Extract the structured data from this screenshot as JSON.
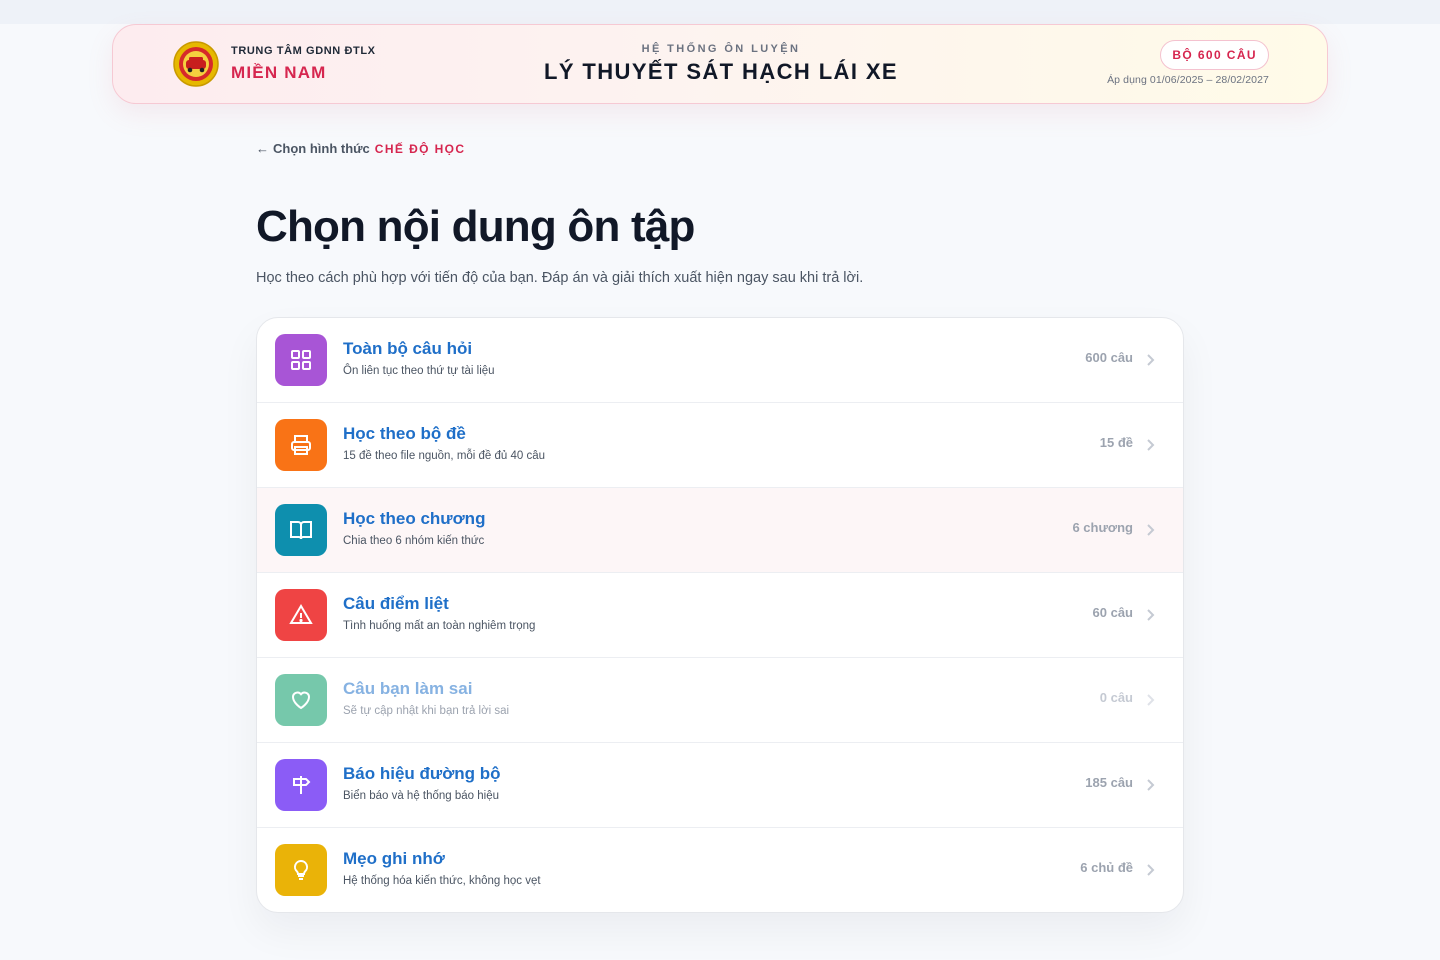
{
  "header": {
    "org_small": "TRUNG TÂM GDNN ĐTLX",
    "org_big": "MIỀN NAM",
    "system_small": "HỆ THỐNG ÔN LUYỆN",
    "system_title": "LÝ THUYẾT SÁT HẠCH LÁI XE",
    "badge": "BỘ 600 CÂU",
    "apply": "Áp dụng 01/06/2025 – 28/02/2027"
  },
  "back": {
    "arrow": "←",
    "label": "Chọn hình thức",
    "mode": "CHẾ ĐỘ HỌC"
  },
  "page": {
    "title": "Chọn nội dung ôn tập",
    "subtitle": "Học theo cách phù hợp với tiến độ của bạn. Đáp án và giải thích xuất hiện ngay sau khi trả lời."
  },
  "items": [
    {
      "title": "Toàn bộ câu hỏi",
      "desc": "Ôn liên tục theo thứ tự tài liệu",
      "count": "600 câu",
      "icon": "grid-icon",
      "color": "#a855d6"
    },
    {
      "title": "Học theo bộ đề",
      "desc": "15 đề theo file nguồn, mỗi đề đủ 40 câu",
      "count": "15 đề",
      "icon": "printer-icon",
      "color": "#f97316"
    },
    {
      "title": "Học theo chương",
      "desc": "Chia theo 6 nhóm kiến thức",
      "count": "6 chương",
      "icon": "book-icon",
      "color": "#0e8fae"
    },
    {
      "title": "Câu điểm liệt",
      "desc": "Tình huống mất an toàn nghiêm trọng",
      "count": "60 câu",
      "icon": "warning-icon",
      "color": "#ef4444"
    },
    {
      "title": "Câu bạn làm sai",
      "desc": "Sẽ tự cập nhật khi bạn trả lời sai",
      "count": "0 câu",
      "icon": "heart-icon",
      "color": "#5fbf9d"
    },
    {
      "title": "Báo hiệu đường bộ",
      "desc": "Biển báo và hệ thống báo hiệu",
      "count": "185 câu",
      "icon": "signpost-icon",
      "color": "#8b5cf6"
    },
    {
      "title": "Mẹo ghi nhớ",
      "desc": "Hệ thống hóa kiến thức, không học vẹt",
      "count": "6 chủ đề",
      "icon": "lightbulb-icon",
      "color": "#eab308"
    }
  ],
  "colors": {
    "accent": "#d6264f",
    "link": "#1f6fc8"
  }
}
